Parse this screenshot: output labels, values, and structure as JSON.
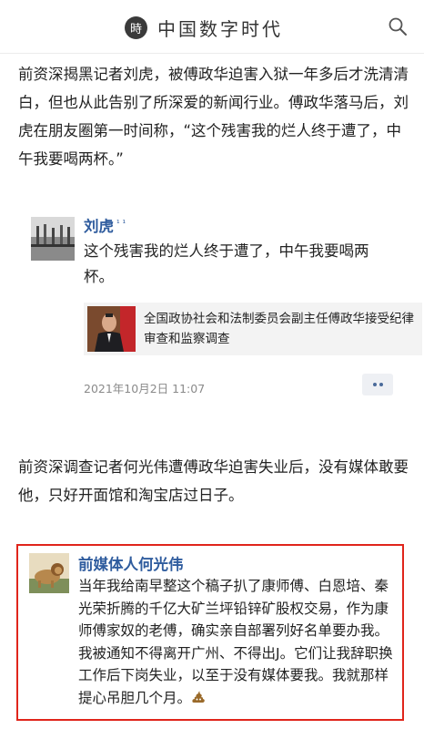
{
  "header": {
    "logo_char": "時",
    "title": "中国数字时代"
  },
  "article": {
    "paragraph1": "前资深揭黑记者刘虎，被傅政华迫害入狱一年多后才洗清清白，但也从此告别了所深爱的新闻行业。傅政华落马后，刘虎在朋友圈第一时间称，“这个残害我的烂人终于遭了，中午我要喝两杯。”",
    "paragraph2": "前资深调查记者何光伟遭傅政华迫害失业后，没有媒体敢要他，只好开面馆和淘宝店过日子。"
  },
  "post1": {
    "author": "刘虎",
    "author_suffix": "¹ ¹",
    "text": "这个残害我的烂人终于遭了，中午我要喝两杯。",
    "share_title": "全国政协社会和法制委员会副主任傅政华接受纪律审查和监察调查",
    "timestamp": "2021年10月2日 11:07"
  },
  "post2": {
    "author": "前媒体人何光伟",
    "text": "当年我给南早整这个稿子扒了康师傅、白恩培、秦光荣折腾的千亿大矿兰坪铅锌矿股权交易，作为康师傅家奴的老傅，确实亲自部署列好名单要办我。我被通知不得离开广州、不得出J。它们让我辞职换工作后下岗失业，以至于没有媒体要我。我就那样提心吊胆几个月。",
    "highlight_color": "#e0251b"
  },
  "icons": [
    "search-icon",
    "more-icon",
    "poop-emoji-icon"
  ]
}
